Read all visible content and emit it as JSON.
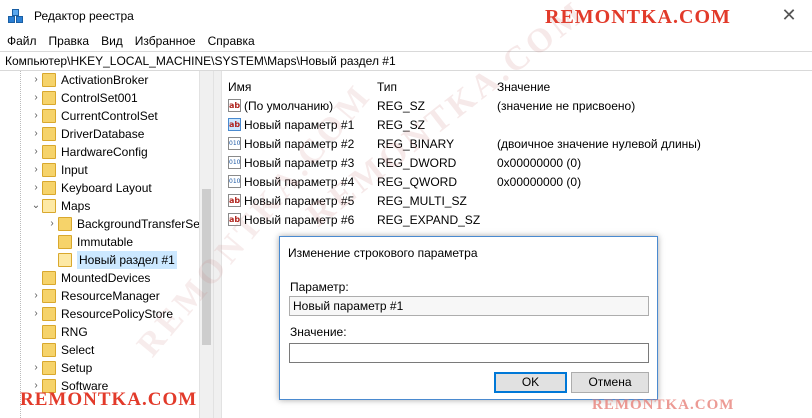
{
  "window": {
    "title": "Редактор реестра",
    "brand": "REMONTKA.COM",
    "close_glyph": "✕"
  },
  "menu": [
    "Файл",
    "Правка",
    "Вид",
    "Избранное",
    "Справка"
  ],
  "address": "Компьютер\\HKEY_LOCAL_MACHINE\\SYSTEM\\Maps\\Новый раздел #1",
  "tree": {
    "items": [
      {
        "label": "ActivationBroker",
        "expander": "›"
      },
      {
        "label": "ControlSet001",
        "expander": "›"
      },
      {
        "label": "CurrentControlSet",
        "expander": "›"
      },
      {
        "label": "DriverDatabase",
        "expander": "›"
      },
      {
        "label": "HardwareConfig",
        "expander": "›"
      },
      {
        "label": "Input",
        "expander": "›"
      },
      {
        "label": "Keyboard Layout",
        "expander": "›"
      },
      {
        "label": "Maps",
        "expander": "⌄"
      },
      {
        "label": "BackgroundTransferSe",
        "expander": "›"
      },
      {
        "label": "Immutable",
        "expander": ""
      },
      {
        "label": "Новый раздел #1",
        "expander": ""
      },
      {
        "label": "MountedDevices",
        "expander": ""
      },
      {
        "label": "ResourceManager",
        "expander": "›"
      },
      {
        "label": "ResourcePolicyStore",
        "expander": "›"
      },
      {
        "label": "RNG",
        "expander": ""
      },
      {
        "label": "Select",
        "expander": ""
      },
      {
        "label": "Setup",
        "expander": "›"
      },
      {
        "label": "Software",
        "expander": "›"
      }
    ]
  },
  "values": {
    "headers": {
      "name": "Имя",
      "type": "Тип",
      "data": "Значение"
    },
    "rows": [
      {
        "icon": "ab",
        "icon_label": "ab",
        "name": "(По умолчанию)",
        "type": "REG_SZ",
        "data": "(значение не присвоено)"
      },
      {
        "icon": "ab",
        "icon_label": "ab",
        "name": "Новый параметр #1",
        "type": "REG_SZ",
        "data": ""
      },
      {
        "icon": "bin",
        "icon_label": "010",
        "name": "Новый параметр #2",
        "type": "REG_BINARY",
        "data": "(двоичное значение нулевой длины)"
      },
      {
        "icon": "bin",
        "icon_label": "010",
        "name": "Новый параметр #3",
        "type": "REG_DWORD",
        "data": "0x00000000 (0)"
      },
      {
        "icon": "bin",
        "icon_label": "010",
        "name": "Новый параметр #4",
        "type": "REG_QWORD",
        "data": "0x00000000 (0)"
      },
      {
        "icon": "ab",
        "icon_label": "ab",
        "name": "Новый параметр #5",
        "type": "REG_MULTI_SZ",
        "data": ""
      },
      {
        "icon": "ab",
        "icon_label": "ab",
        "name": "Новый параметр #6",
        "type": "REG_EXPAND_SZ",
        "data": ""
      }
    ]
  },
  "dialog": {
    "title": "Изменение строкового параметра",
    "param_label": "Параметр:",
    "param_value": "Новый параметр #1",
    "value_label": "Значение:",
    "value_value": "",
    "ok_label": "OK",
    "cancel_label": "Отмена"
  },
  "colors": {
    "accent": "#0078d7",
    "brand": "#e23a2a",
    "selection": "#cce8ff"
  }
}
